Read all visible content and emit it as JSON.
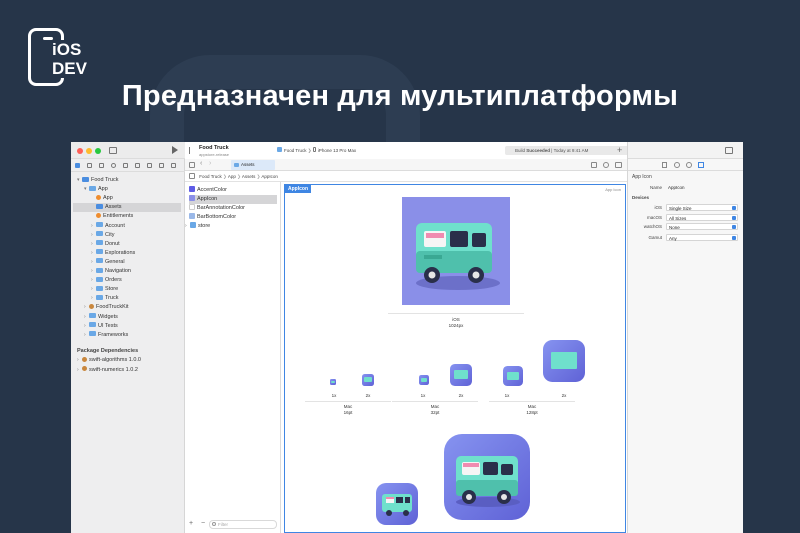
{
  "colors": {
    "background": "#263549",
    "accent": "#3f86e3",
    "close": "#ff5f57",
    "minimize": "#febc2e",
    "zoom": "#28c840"
  },
  "brand": {
    "line1": "iOS",
    "line2": "DEV"
  },
  "headline": "Предназначен для мультиплатформы",
  "toolbar": {
    "project_title": "Food Truck",
    "project_subtitle": "appstore-release",
    "scheme_target": "Food Truck",
    "scheme_device": "iPhone 13 Pro Max",
    "status_prefix": "Build ",
    "status_bold": "Succeeded",
    "status_time": " | Today at 9:41 AM",
    "add_label": "+"
  },
  "tabs": [
    {
      "label": "Assets"
    }
  ],
  "breadcrumb": [
    "Food Truck",
    "App",
    "Assets",
    "AppIcon"
  ],
  "navigator": {
    "items": [
      {
        "label": "Food Truck",
        "indent": 0,
        "chev": "▾",
        "icon": "blue",
        "selected": false
      },
      {
        "label": "App",
        "indent": 1,
        "chev": "▾",
        "icon": "folder",
        "selected": false
      },
      {
        "label": "App",
        "indent": 2,
        "chev": "",
        "icon": "orange",
        "selected": false
      },
      {
        "label": "Assets",
        "indent": 2,
        "chev": "",
        "icon": "blue",
        "selected": true
      },
      {
        "label": "Entitlements",
        "indent": 2,
        "chev": "",
        "icon": "orange",
        "selected": false
      },
      {
        "label": "Account",
        "indent": 2,
        "chev": "›",
        "icon": "folder",
        "selected": false
      },
      {
        "label": "City",
        "indent": 2,
        "chev": "›",
        "icon": "folder",
        "selected": false
      },
      {
        "label": "Donut",
        "indent": 2,
        "chev": "›",
        "icon": "folder",
        "selected": false
      },
      {
        "label": "Explorations",
        "indent": 2,
        "chev": "›",
        "icon": "folder",
        "selected": false
      },
      {
        "label": "General",
        "indent": 2,
        "chev": "›",
        "icon": "folder",
        "selected": false
      },
      {
        "label": "Navigation",
        "indent": 2,
        "chev": "›",
        "icon": "folder",
        "selected": false
      },
      {
        "label": "Orders",
        "indent": 2,
        "chev": "›",
        "icon": "folder",
        "selected": false
      },
      {
        "label": "Store",
        "indent": 2,
        "chev": "›",
        "icon": "folder",
        "selected": false
      },
      {
        "label": "Truck",
        "indent": 2,
        "chev": "›",
        "icon": "folder",
        "selected": false
      },
      {
        "label": "FoodTruckKit",
        "indent": 1,
        "chev": "›",
        "icon": "pkg",
        "selected": false
      },
      {
        "label": "Widgets",
        "indent": 1,
        "chev": "›",
        "icon": "folder",
        "selected": false
      },
      {
        "label": "UI Tests",
        "indent": 1,
        "chev": "›",
        "icon": "folder",
        "selected": false
      },
      {
        "label": "Frameworks",
        "indent": 1,
        "chev": "›",
        "icon": "folder",
        "selected": false
      }
    ],
    "dependencies_title": "Package Dependencies",
    "dependencies": [
      {
        "label": "swift-algorithms 1.0.0"
      },
      {
        "label": "swift-numerics 1.0.2"
      }
    ]
  },
  "asset_list": {
    "items": [
      {
        "label": "AccentColor",
        "swatch": "#5e5ce6",
        "selected": false
      },
      {
        "label": "AppIcon",
        "swatch": "#8a8fe8",
        "selected": true
      },
      {
        "label": "BarAnnotationColor",
        "swatch": "#ffffff",
        "selected": false
      },
      {
        "label": "BarBottomColor",
        "swatch": "#9ab8e8",
        "selected": false
      },
      {
        "label": "store",
        "swatch": "#6aa8e6",
        "selected": false
      }
    ],
    "filter_placeholder": "Filter",
    "add_label": "+",
    "remove_label": "−"
  },
  "editor": {
    "label": "AppIcon",
    "kind": "App Icon",
    "ios_caption": "iOS",
    "ios_size": "1024px",
    "groups": [
      {
        "scale1": "1x",
        "scale2": "2x",
        "platform": "Mac",
        "size": "16pt"
      },
      {
        "scale1": "1x",
        "scale2": "2x",
        "platform": "Mac",
        "size": "32pt"
      },
      {
        "scale1": "1x",
        "scale2": "2x",
        "platform": "Mac",
        "size": "128pt"
      }
    ]
  },
  "inspector": {
    "header": "App Icon",
    "name_key": "Name",
    "name_value": "AppIcon",
    "devices_title": "Devices",
    "rows": [
      {
        "key": "iOS",
        "value": "Single Size"
      },
      {
        "key": "macOS",
        "value": "All Sizes"
      },
      {
        "key": "watchOS",
        "value": "None"
      }
    ],
    "gamut_key": "Gamut",
    "gamut_value": "Any"
  }
}
